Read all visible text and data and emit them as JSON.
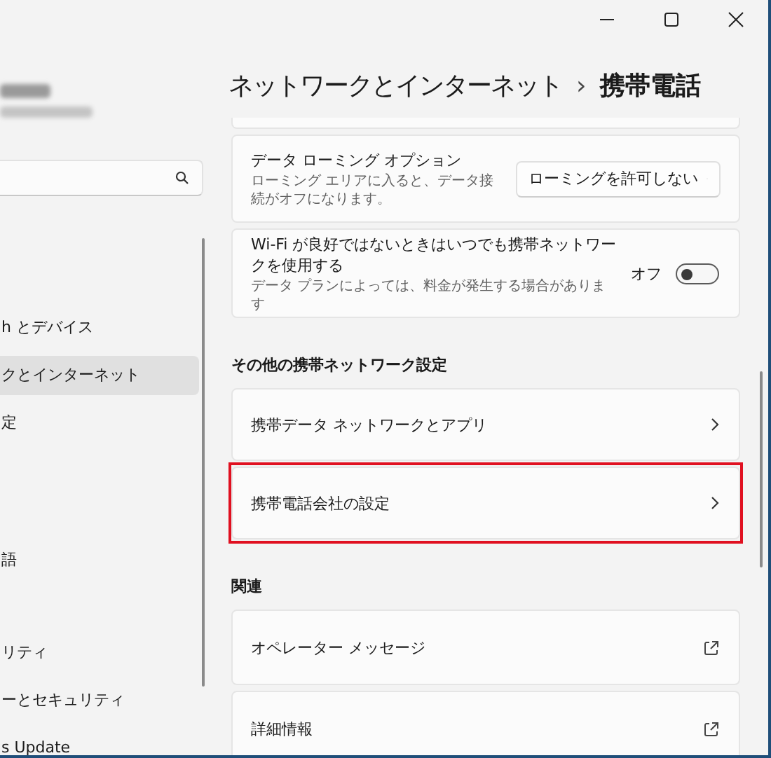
{
  "sidebar": {
    "items": [
      {
        "label": "h とデバイス",
        "selected": false
      },
      {
        "label": "クとインターネット",
        "selected": true
      },
      {
        "label": "定",
        "selected": false
      },
      {
        "label": "語",
        "selected": false
      },
      {
        "label": "リティ",
        "selected": false
      },
      {
        "label": "ーとセキュリティ",
        "selected": false
      },
      {
        "label": "s Update",
        "selected": false
      }
    ]
  },
  "header": {
    "breadcrumb": "ネットワークとインターネット",
    "separator": "›",
    "title": "携帯電話"
  },
  "sections": [
    {
      "items": [
        {
          "kind": "dropdown",
          "title": "データ ローミング オプション",
          "description": "ローミング エリアに入ると、データ接続がオフになります。",
          "value": "ローミングを許可しない",
          "highlighted": false
        },
        {
          "kind": "toggle",
          "title": "Wi-Fi が良好ではないときはいつでも携帯ネットワークを使用する",
          "description": "データ プランによっては、料金が発生する場合があります",
          "state_label": "オフ",
          "on": false,
          "highlighted": false
        }
      ]
    },
    {
      "heading": "その他の携帯ネットワーク設定",
      "items": [
        {
          "kind": "nav",
          "title": "携帯データ ネットワークとアプリ",
          "highlighted": false
        },
        {
          "kind": "nav",
          "title": "携帯電話会社の設定",
          "highlighted": true
        }
      ]
    },
    {
      "heading": "関連",
      "items": [
        {
          "kind": "external",
          "title": "オペレーター メッセージ",
          "highlighted": false
        },
        {
          "kind": "external",
          "title": "詳細情報",
          "highlighted": false
        }
      ]
    }
  ]
}
